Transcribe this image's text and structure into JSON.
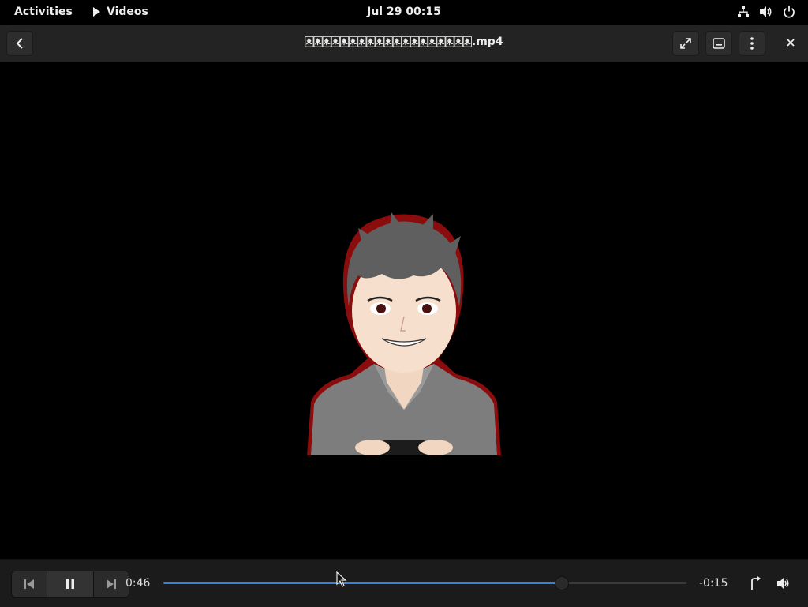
{
  "topbar": {
    "activities": "Activities",
    "app_name": "Videos",
    "clock": "Jul 29  00:15",
    "tray_icons": [
      "network-icon",
      "volume-icon",
      "power-icon"
    ]
  },
  "headerbar": {
    "title": "🀀🀀🀀🀀🀀🀀🀀🀀🀀🀀🀀🀀🀀🀀🀀🀀🀀🀀🀀.mp4",
    "buttons": [
      "back-icon",
      "fullscreen-icon",
      "subtitles-icon",
      "menu-dots-icon",
      "close-icon"
    ]
  },
  "player": {
    "elapsed": "0:46",
    "remaining": "-0:15",
    "progress": 0.76,
    "buffered": 0.76,
    "colors": {
      "accent": "#3584e4",
      "panel": "#232323",
      "controls": "#1b1b1b"
    }
  }
}
